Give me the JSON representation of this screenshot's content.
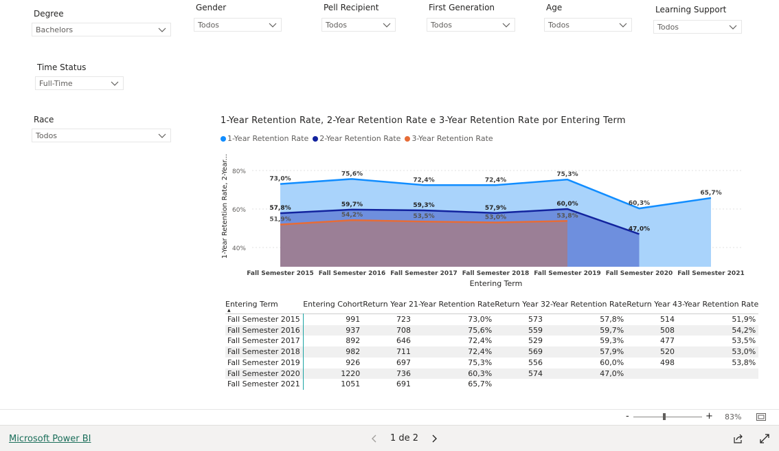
{
  "slicers": {
    "degree": {
      "label": "Degree",
      "value": "Bachelors"
    },
    "gender": {
      "label": "Gender",
      "value": "Todos"
    },
    "pell": {
      "label": "Pell Recipient",
      "value": "Todos"
    },
    "first_gen": {
      "label": "First Generation",
      "value": "Todos"
    },
    "age": {
      "label": "Age",
      "value": "Todos"
    },
    "learning_support": {
      "label": "Learning Support",
      "value": "Todos"
    },
    "time_status": {
      "label": "Time Status",
      "value": "Full-Time"
    },
    "race": {
      "label": "Race",
      "value": "Todos"
    }
  },
  "chart_data": {
    "type": "area",
    "title": "1-Year Retention Rate, 2-Year Retention Rate e 3-Year Retention Rate por Entering Term",
    "xlabel": "Entering Term",
    "ylabel": "1-Year Retention Rate, 2-Year...",
    "categories": [
      "Fall Semester 2015",
      "Fall Semester 2016",
      "Fall Semester 2017",
      "Fall Semester 2018",
      "Fall Semester 2019",
      "Fall Semester 2020",
      "Fall Semester 2021"
    ],
    "y_ticks": [
      "80%",
      "60%",
      "40%"
    ],
    "ylim": [
      30,
      85
    ],
    "series": [
      {
        "name": "1-Year Retention Rate",
        "color": "#118dff",
        "fill": "#a9d3fb",
        "values": [
          73.0,
          75.6,
          72.4,
          72.4,
          75.3,
          60.3,
          65.7
        ],
        "labels": [
          "73,0%",
          "75,6%",
          "72,4%",
          "72,4%",
          "75,3%",
          "60,3%",
          "65,7%"
        ]
      },
      {
        "name": "2-Year Retention Rate",
        "color": "#12239e",
        "fill": "#6e8fde",
        "values": [
          57.8,
          59.7,
          59.3,
          57.9,
          60.0,
          47.0
        ],
        "labels": [
          "57,8%",
          "59,7%",
          "59,3%",
          "57,9%",
          "60,0%",
          "47,0%"
        ]
      },
      {
        "name": "3-Year Retention Rate",
        "color": "#e66c37",
        "fill": "#9b7f96",
        "values": [
          51.9,
          54.2,
          53.5,
          53.0,
          53.8
        ],
        "labels": [
          "51,9%",
          "54,2%",
          "53,5%",
          "53,0%",
          "53,8%"
        ]
      }
    ],
    "grid": true,
    "legend_position": "top-left"
  },
  "table": {
    "headers": [
      "Entering Term",
      "Entering Cohort",
      "Return Year 2",
      "1-Year Retention Rate",
      "Return Year 3",
      "2-Year Retention Rate",
      "Return Year 4",
      "3-Year Retention Rate"
    ],
    "rows": [
      [
        "Fall Semester 2015",
        "991",
        "723",
        "73,0%",
        "573",
        "57,8%",
        "514",
        "51,9%"
      ],
      [
        "Fall Semester 2016",
        "937",
        "708",
        "75,6%",
        "559",
        "59,7%",
        "508",
        "54,2%"
      ],
      [
        "Fall Semester 2017",
        "892",
        "646",
        "72,4%",
        "529",
        "59,3%",
        "477",
        "53,5%"
      ],
      [
        "Fall Semester 2018",
        "982",
        "711",
        "72,4%",
        "569",
        "57,9%",
        "520",
        "53,0%"
      ],
      [
        "Fall Semester 2019",
        "926",
        "697",
        "75,3%",
        "556",
        "60,0%",
        "498",
        "53,8%"
      ],
      [
        "Fall Semester 2020",
        "1220",
        "736",
        "60,3%",
        "574",
        "47,0%",
        "",
        ""
      ],
      [
        "Fall Semester 2021",
        "1051",
        "691",
        "65,7%",
        "",
        "",
        "",
        ""
      ]
    ]
  },
  "zoom": {
    "minus": "-",
    "plus": "+",
    "level": "83%",
    "fraction": 0.45
  },
  "footer": {
    "brand": "Microsoft Power BI",
    "page": "1 de 2"
  }
}
